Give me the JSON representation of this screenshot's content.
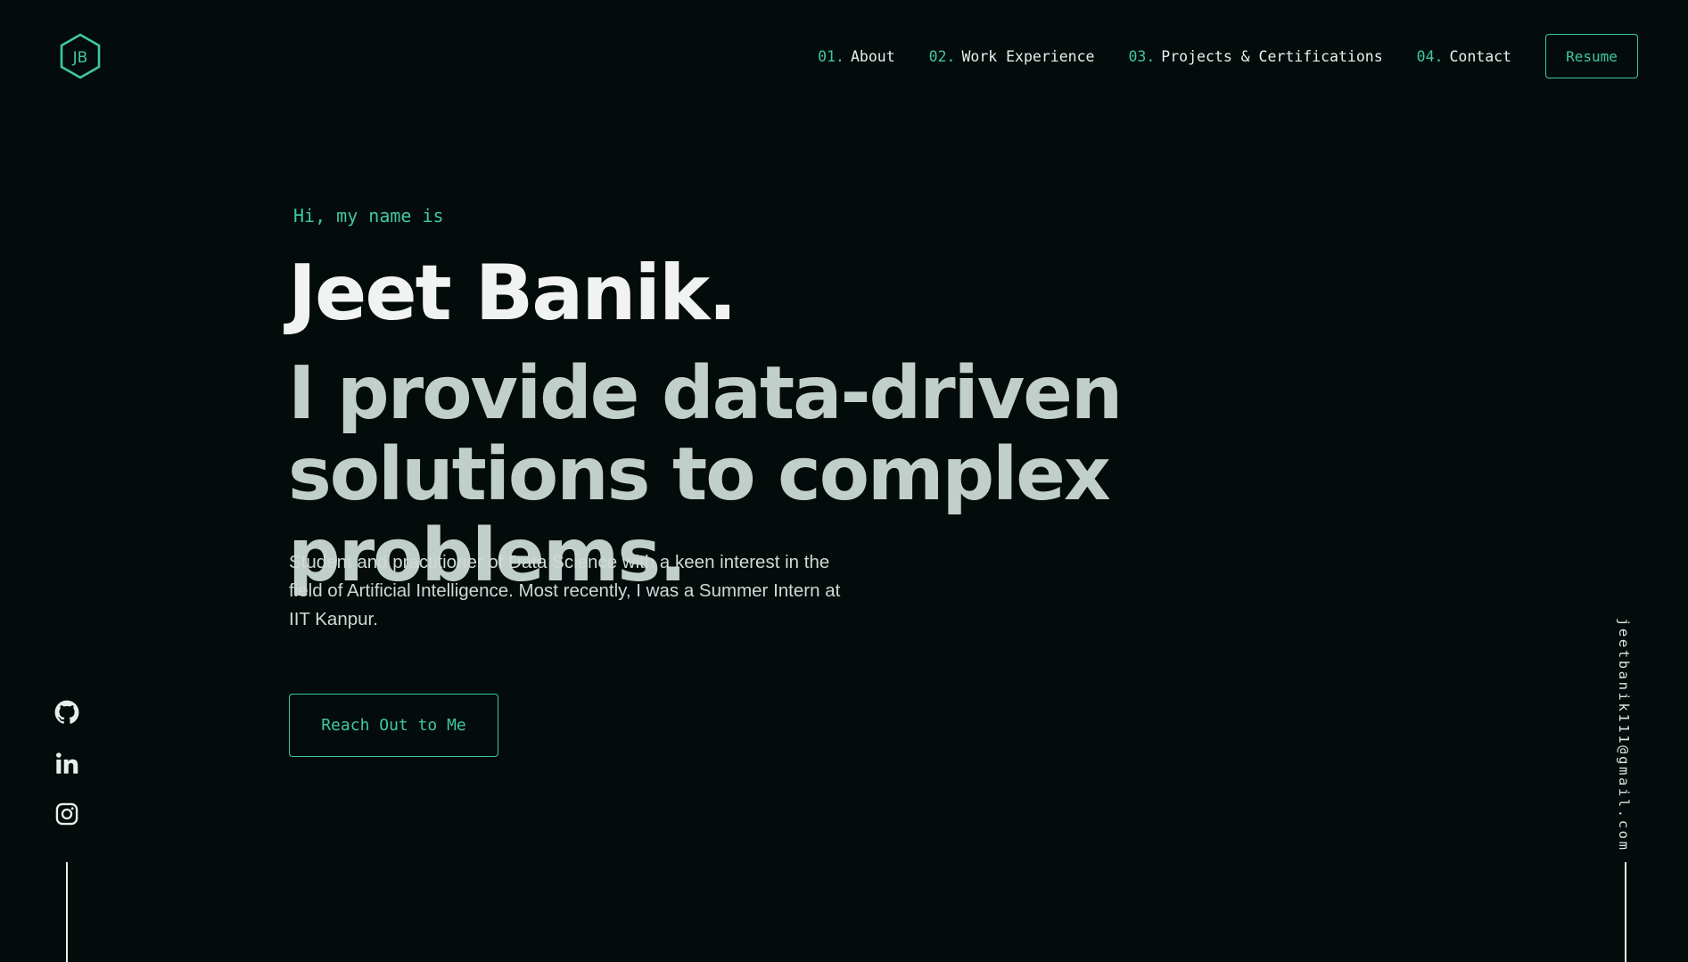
{
  "colors": {
    "background": "#040b0b",
    "accent": "#3ec9a0",
    "heading": "#f0f3f2",
    "subheading": "#c1cfca"
  },
  "logo": {
    "text": "JB",
    "icon": "hexagon-logo-icon"
  },
  "nav": {
    "items": [
      {
        "num": "01.",
        "label": "About"
      },
      {
        "num": "02.",
        "label": "Work Experience"
      },
      {
        "num": "03.",
        "label": "Projects & Certifications"
      },
      {
        "num": "04.",
        "label": "Contact"
      }
    ],
    "resume_label": "Resume"
  },
  "hero": {
    "greeting": "Hi, my name is",
    "name": "Jeet Banik.",
    "tagline": "I provide data-driven solutions to complex problems.",
    "bio": "Student and practitioner of Data Science with a keen interest in the field of Artificial Intelligence. Most recently, I was a Summer Intern at IIT Kanpur.",
    "cta_label": "Reach Out to Me"
  },
  "social": [
    {
      "icon": "github-icon"
    },
    {
      "icon": "linkedin-icon"
    },
    {
      "icon": "instagram-icon"
    }
  ],
  "email": "jeetbanik111@gmail.com"
}
